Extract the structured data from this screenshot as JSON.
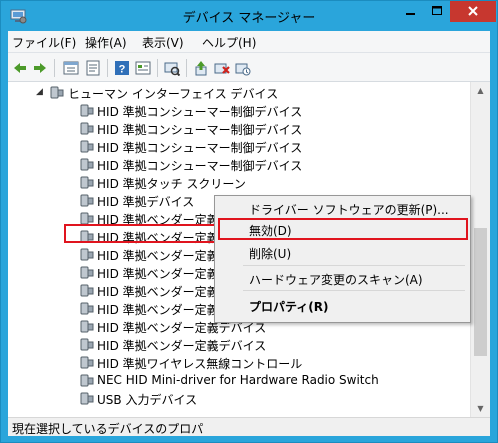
{
  "window": {
    "title": "デバイス マネージャー"
  },
  "menu": [
    "ファイル(F)",
    "操作(A)",
    "表示(V)",
    "ヘルプ(H)"
  ],
  "toolbar_icons": [
    "back-icon",
    "forward-icon",
    "properties-grid-icon",
    "properties-sheet-icon",
    "help-icon",
    "view-resources-icon",
    "scan-hardware-icon",
    "update-driver-icon",
    "uninstall-icon",
    "enable-device-icon"
  ],
  "tree": {
    "category": "ヒューマン インターフェイス デバイス",
    "devices": [
      "HID 準拠コンシューマー制御デバイス",
      "HID 準拠コンシューマー制御デバイス",
      "HID 準拠コンシューマー制御デバイス",
      "HID 準拠コンシューマー制御デバイス",
      "HID 準拠タッチ スクリーン",
      "HID 準拠デバイス",
      "HID 準拠ベンダー定義デ",
      "HID 準拠ベンダー定義デ",
      "HID 準拠ベンダー定義デ",
      "HID 準拠ベンダー定義デ",
      "HID 準拠ベンダー定義デ",
      "HID 準拠ベンダー定義デ",
      "HID 準拠ベンダー定義デバイス",
      "HID 準拠ベンダー定義デバイス",
      "HID 準拠ワイヤレス無線コントロール",
      "NEC HID Mini-driver for Hardware Radio Switch",
      "USB 入力デバイス"
    ]
  },
  "context_menu": {
    "update_driver": "ドライバー ソフトウェアの更新(P)...",
    "disable": "無効(D)",
    "uninstall": "削除(U)",
    "scan": "ハードウェア変更のスキャン(A)",
    "properties": "プロパティ(R)"
  },
  "status": "現在選択しているデバイスのプロパ",
  "colors": {
    "titlebar": "#2aa5db",
    "close_button": "#c7372f",
    "highlight_border": "#e0141e"
  }
}
